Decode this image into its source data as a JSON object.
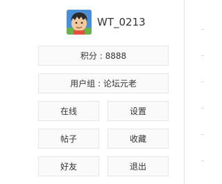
{
  "user": {
    "name": "WT_0213",
    "avatar_icon": "cartoon-boy-avatar-icon"
  },
  "profile": {
    "points_label": "积分 : 8888",
    "group_label": "用户组 : 论坛元老"
  },
  "menu": {
    "online": "在线",
    "settings": "设置",
    "posts": "帖子",
    "favorites": "收藏",
    "friends": "好友",
    "logout": "退出"
  },
  "colors": {
    "button_bg": "#fafafa",
    "button_border": "#e6e6e6",
    "text": "#333333"
  }
}
